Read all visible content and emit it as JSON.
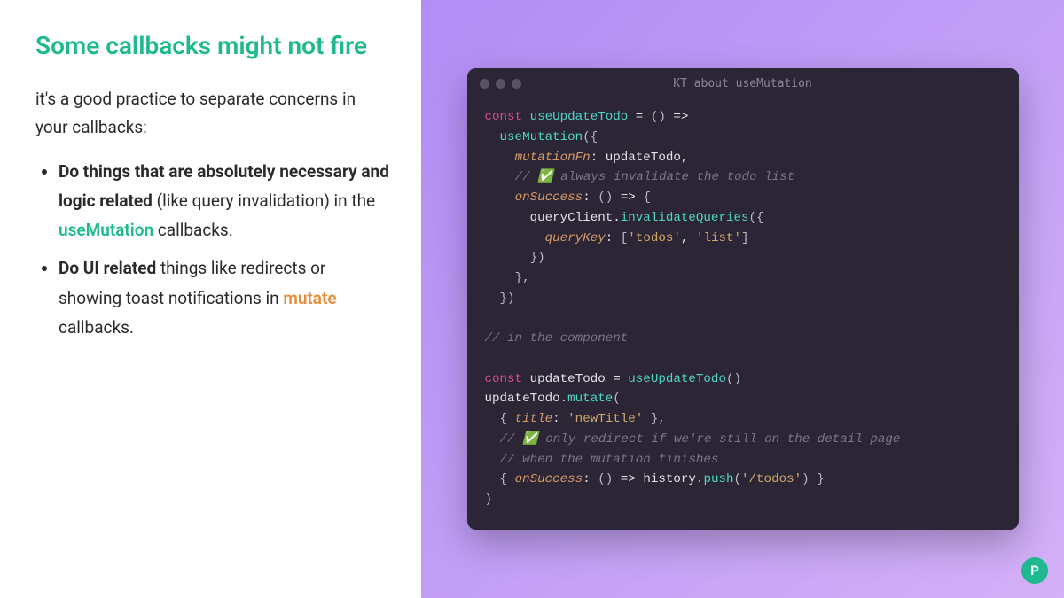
{
  "slide": {
    "title": "Some callbacks might not fire",
    "intro": "it's a good practice to separate concerns in your callbacks:",
    "bullets": [
      {
        "bold": "Do things that are absolutely necessary and logic related",
        "rest1": " (like query invalidation) in the ",
        "keyword": "useMutation",
        "rest2": " callbacks."
      },
      {
        "bold": "Do UI related",
        "rest1": " things like redirects or showing toast notifications in ",
        "keyword": "mutate",
        "rest2": " callbacks."
      }
    ]
  },
  "code": {
    "window_title": "KT about useMutation",
    "tokens": {
      "kw_const1": "const",
      "fn_useUpdateTodo": "useUpdateTodo",
      "eq1": " = ",
      "paren_open1": "(",
      "paren_close1": ")",
      "arrow1": " =>",
      "fn_useMutation": "useMutation",
      "brace_open1": "({",
      "prop_mutationFn": "mutationFn",
      "colon1": ": ",
      "val_updateTodo": "updateTodo",
      "comma1": ",",
      "comment1": "// ✅ always invalidate the todo list",
      "prop_onSuccess1": "onSuccess",
      "colon2": ": ",
      "arrow2": "()",
      "arrow3": " => ",
      "brace_open2": "{",
      "val_queryClient": "queryClient",
      "dot1": ".",
      "fn_invalidateQueries": "invalidateQueries",
      "brace_open3": "({",
      "prop_queryKey": "queryKey",
      "colon3": ": ",
      "bracket_open": "[",
      "str_todos": "'todos'",
      "comma2": ", ",
      "str_list": "'list'",
      "bracket_close": "]",
      "brace_close3": "})",
      "brace_close2": "},",
      "brace_close1": "})",
      "comment2": "// in the component",
      "kw_const2": "const",
      "val_updateTodo2": "updateTodo",
      "eq2": " = ",
      "fn_useUpdateTodo2": "useUpdateTodo",
      "call2": "()",
      "val_updateTodo3": "updateTodo",
      "dot2": ".",
      "fn_mutate": "mutate",
      "paren_open2": "(",
      "brace_open4": "{ ",
      "prop_title": "title",
      "colon4": ": ",
      "str_newTitle": "'newTitle'",
      "brace_close4": " },",
      "comment3": "// ✅ only redirect if we're still on the detail page",
      "comment4": "// when the mutation finishes",
      "brace_open5": "{ ",
      "prop_onSuccess2": "onSuccess",
      "colon5": ": ",
      "arrow4": "()",
      "arrow5": " => ",
      "val_history": "history",
      "dot3": ".",
      "fn_push": "push",
      "paren_open3": "(",
      "str_todos_path": "'/todos'",
      "paren_close3": ")",
      "brace_close5": " }",
      "paren_close2": ")"
    }
  },
  "logo": {
    "letter": "P"
  }
}
